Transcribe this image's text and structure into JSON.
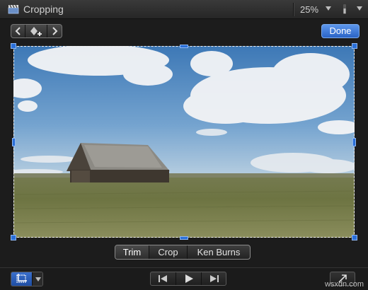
{
  "window": {
    "title": "Cropping",
    "zoom": "25%",
    "icons": [
      "clapperboard-icon",
      "zoom-dropdown-icon",
      "view-switch-icon"
    ]
  },
  "toolbar": {
    "nav_icons": [
      "back-arrow-icon",
      "add-keyframe-icon",
      "forward-arrow-icon"
    ],
    "done_label": "Done"
  },
  "viewer": {
    "image": "landscape: old barn on wheat field under cloudy blue sky"
  },
  "modes": {
    "items": [
      "Trim",
      "Crop",
      "Ken Burns"
    ],
    "active": "Trim"
  },
  "bottom": {
    "tool_icons": [
      "crop-tool-icon",
      "dropdown-icon"
    ],
    "transport_icons": [
      "skip-back-icon",
      "play-icon",
      "skip-forward-icon"
    ],
    "expand_icon": "fullscreen-icon",
    "watermark": "wsxdn.com"
  }
}
